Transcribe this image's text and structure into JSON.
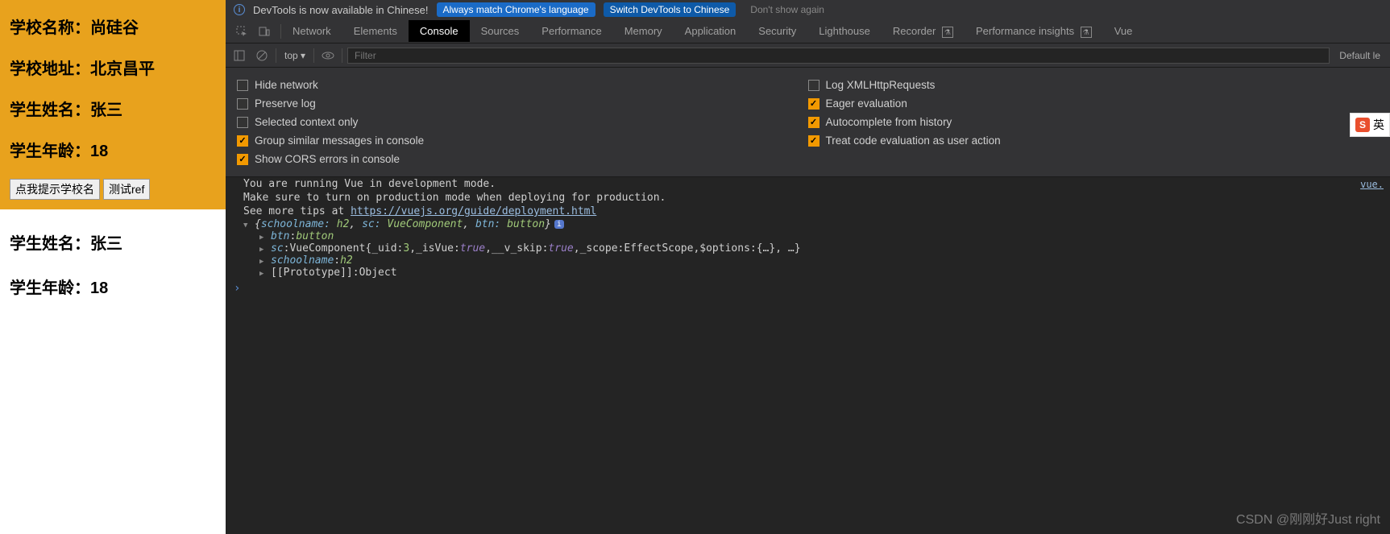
{
  "left": {
    "school_name_label": "学校名称：",
    "school_name_value": "尚硅谷",
    "school_addr_label": "学校地址：",
    "school_addr_value": "北京昌平",
    "student_name_label": "学生姓名：",
    "student_name_value": "张三",
    "student_age_label": "学生年龄：",
    "student_age_value": "18",
    "btn1": "点我提示学校名",
    "btn2": "测试ref",
    "student_name_label2": "学生姓名：",
    "student_name_value2": "张三",
    "student_age_label2": "学生年龄：",
    "student_age_value2": "18"
  },
  "infobar": {
    "text": "DevTools is now available in Chinese!",
    "btn1": "Always match Chrome's language",
    "btn2": "Switch DevTools to Chinese",
    "btn3": "Don't show again"
  },
  "tabs": {
    "network": "Network",
    "elements": "Elements",
    "console": "Console",
    "sources": "Sources",
    "performance": "Performance",
    "memory": "Memory",
    "application": "Application",
    "security": "Security",
    "lighthouse": "Lighthouse",
    "recorder": "Recorder",
    "perfinsights": "Performance insights",
    "vue": "Vue"
  },
  "toolbar": {
    "top": "top ▾",
    "filter_placeholder": "Filter",
    "default_levels": "Default le"
  },
  "settings": {
    "hide_network": "Hide network",
    "preserve_log": "Preserve log",
    "selected_ctx": "Selected context only",
    "group_similar": "Group similar messages in console",
    "show_cors": "Show CORS errors in console",
    "log_xhr": "Log XMLHttpRequests",
    "eager_eval": "Eager evaluation",
    "autocomplete": "Autocomplete from history",
    "treat_code": "Treat code evaluation as user action"
  },
  "console": {
    "line1": "You are running Vue in development mode.",
    "line2": "Make sure to turn on production mode when deploying for production.",
    "line3_pre": "See more tips at ",
    "line3_link": "https://vuejs.org/guide/deployment.html",
    "vue_src": "vue.",
    "obj_summary_open": "{",
    "obj_p1": "schoolname:",
    "obj_v1": "h2",
    "obj_p2": "sc:",
    "obj_v2": "VueComponent",
    "obj_p3": "btn:",
    "obj_v3": "button",
    "obj_summary_close": "}",
    "btn_key": "btn",
    "btn_val": "button",
    "sc_key": "sc",
    "sc_type": "VueComponent ",
    "sc_uid_k": "_uid:",
    "sc_uid_v": "3",
    "sc_isvue_k": "_isVue:",
    "sc_isvue_v": "true",
    "sc_vskip_k": "__v_skip:",
    "sc_vskip_v": "true",
    "sc_scope_k": "_scope:",
    "sc_scope_v": "EffectScope",
    "sc_opts_k": "$options:",
    "sc_opts_v": "{…}",
    "sc_more": ", …}",
    "schoolname_key": "schoolname",
    "schoolname_val": "h2",
    "proto_key": "[[Prototype]]",
    "proto_val": "Object"
  },
  "watermark": "CSDN @刚刚好Just right",
  "ime": {
    "text": "英"
  }
}
